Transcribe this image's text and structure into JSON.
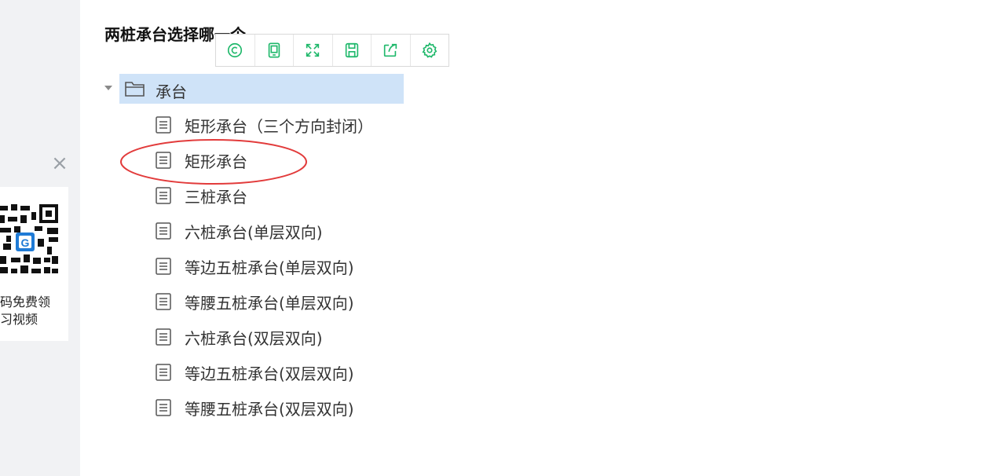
{
  "title": "两桩承台选择哪一个",
  "toolbar": {
    "buttons": [
      {
        "icon": "copyright-icon"
      },
      {
        "icon": "tablet-icon"
      },
      {
        "icon": "fullscreen-icon"
      },
      {
        "icon": "save-icon"
      },
      {
        "icon": "share-icon"
      },
      {
        "icon": "settings-icon"
      }
    ],
    "accent_color": "#1fb86b"
  },
  "tree": {
    "root": {
      "label": "承台",
      "expanded": true,
      "selected": true
    },
    "items": [
      {
        "label": "矩形承台（三个方向封闭）"
      },
      {
        "label": "矩形承台",
        "circled": true
      },
      {
        "label": "三桩承台"
      },
      {
        "label": "六桩承台(单层双向)"
      },
      {
        "label": "等边五桩承台(单层双向)"
      },
      {
        "label": "等腰五桩承台(单层双向)"
      },
      {
        "label": "六桩承台(双层双向)"
      },
      {
        "label": "等边五桩承台(双层双向)"
      },
      {
        "label": "等腰五桩承台(双层双向)"
      }
    ]
  },
  "side_ad": {
    "close_label": "×",
    "caption_line1": "码免费领",
    "caption_line2": "习视频"
  },
  "colors": {
    "selection_bg": "#cfe3f8",
    "annotation_red": "#e23b3b",
    "side_strip": "#f1f2f4"
  }
}
